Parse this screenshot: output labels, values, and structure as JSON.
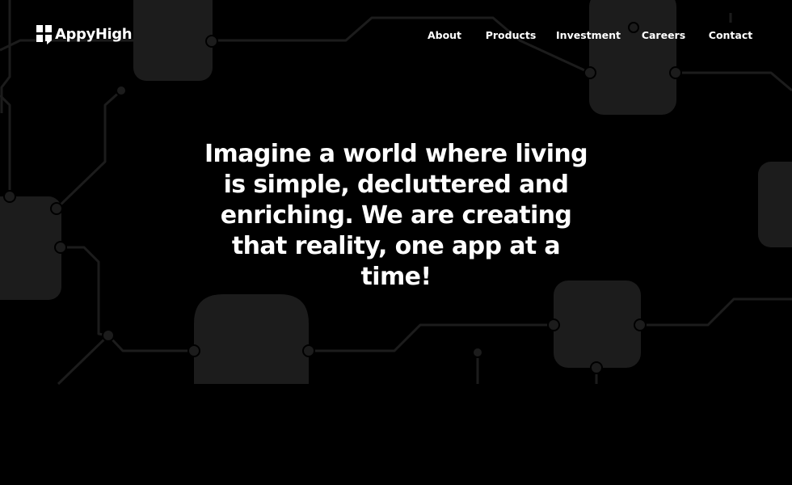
{
  "brand": {
    "name": "AppyHigh"
  },
  "nav": {
    "items": [
      {
        "label": "About"
      },
      {
        "label": "Products"
      },
      {
        "label": "Investment"
      },
      {
        "label": "Careers"
      },
      {
        "label": "Contact"
      }
    ]
  },
  "hero": {
    "headline": "Imagine a world where living is simple, decluttered and enriching. We are creating that reality, one app at a time!"
  },
  "colors": {
    "background": "#000000",
    "text": "#ffffff",
    "circuit": "#1b1b1b"
  }
}
